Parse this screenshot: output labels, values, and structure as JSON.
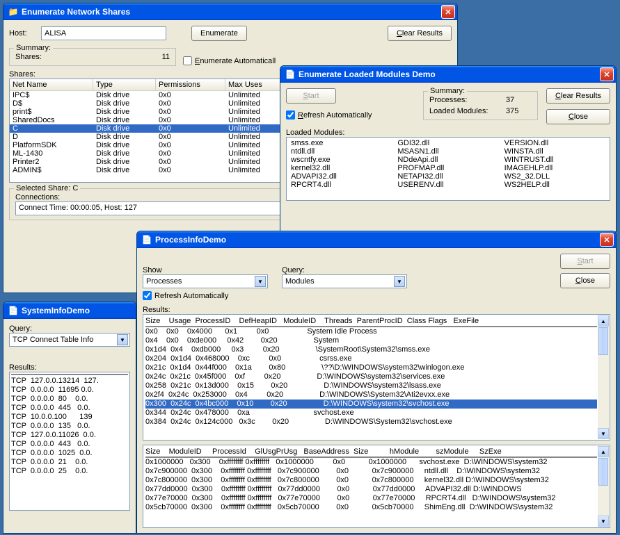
{
  "shares_win": {
    "title": "Enumerate Network Shares",
    "host_label": "Host:",
    "host_value": "ALISA",
    "enumerate_btn": "Enumerate",
    "clear_btn": "Clear Results",
    "summary_label": "Summary:",
    "summary_shares_label": "Shares:",
    "summary_shares_value": "11",
    "auto_label": "Enumerate Automatically",
    "caption": "Shares:",
    "cols": [
      "Net Name",
      "Type",
      "Permissions",
      "Max Uses"
    ],
    "rows": [
      {
        "name": "IPC$",
        "type": "Disk drive",
        "perm": "0x0",
        "max": "Unlimited",
        "sel": false
      },
      {
        "name": "D$",
        "type": "Disk drive",
        "perm": "0x0",
        "max": "Unlimited",
        "sel": false
      },
      {
        "name": "print$",
        "type": "Disk drive",
        "perm": "0x0",
        "max": "Unlimited",
        "sel": false
      },
      {
        "name": "SharedDocs",
        "type": "Disk drive",
        "perm": "0x0",
        "max": "Unlimited",
        "sel": false
      },
      {
        "name": "C",
        "type": "Disk drive",
        "perm": "0x0",
        "max": "Unlimited",
        "sel": true
      },
      {
        "name": "D",
        "type": "Disk drive",
        "perm": "0x0",
        "max": "Unlimited",
        "sel": false
      },
      {
        "name": "PlatformSDK",
        "type": "Disk drive",
        "perm": "0x0",
        "max": "Unlimited",
        "sel": false
      },
      {
        "name": "ML-1430",
        "type": "Disk drive",
        "perm": "0x0",
        "max": "Unlimited",
        "sel": false
      },
      {
        "name": "Printer2",
        "type": "Disk drive",
        "perm": "0x0",
        "max": "Unlimited",
        "sel": false
      },
      {
        "name": "ADMIN$",
        "type": "Disk drive",
        "perm": "0x0",
        "max": "Unlimited",
        "sel": false
      }
    ],
    "selected_legend": "Selected Share: C",
    "connections_label": "Connections:",
    "connections_text": "Connect Time: 00:00:05, Host: 127"
  },
  "modules_win": {
    "title": "Enumerate Loaded Modules Demo",
    "start_btn": "Start",
    "auto_label": "Refresh Automatically",
    "auto_checked": true,
    "summary_label": "Summary:",
    "proc_label": "Processes:",
    "proc_value": "37",
    "mod_label": "Loaded Modules:",
    "mod_value": "375",
    "clear_btn": "Clear Results",
    "close_btn": "Close",
    "caption": "Loaded Modules:",
    "grid": [
      [
        "smss.exe",
        "GDI32.dll",
        "VERSION.dll"
      ],
      [
        "ntdll.dll",
        "MSASN1.dll",
        "WINSTA.dll"
      ],
      [
        "wscntfy.exe",
        "NDdeApi.dll",
        "WINTRUST.dll"
      ],
      [
        "kernel32.dll",
        "PROFMAP.dll",
        "IMAGEHLP.dll"
      ],
      [
        "ADVAPI32.dll",
        "NETAPI32.dll",
        "WS2_32.DLL"
      ],
      [
        "RPCRT4.dll",
        "USERENV.dll",
        "WS2HELP.dll"
      ]
    ]
  },
  "sysinfo_win": {
    "title": "SystemInfoDemo",
    "query_label": "Query:",
    "query_value": "TCP Connect Table Info",
    "results_label": "Results:",
    "rows": [
      [
        "TCP",
        "127.0.0.1",
        "3214",
        "127."
      ],
      [
        "TCP",
        "0.0.0.0",
        "11695",
        "0.0."
      ],
      [
        "TCP",
        "0.0.0.0",
        "80",
        "0.0."
      ],
      [
        "TCP",
        "0.0.0.0",
        "445",
        "0.0."
      ],
      [
        "TCP",
        "10.0.0.100",
        "",
        "139"
      ],
      [
        "TCP",
        "0.0.0.0",
        "135",
        "0.0."
      ],
      [
        "TCP",
        "127.0.0.1",
        "1026",
        "0.0."
      ],
      [
        "TCP",
        "0.0.0.0",
        "443",
        "0.0."
      ],
      [
        "TCP",
        "0.0.0.0",
        "1025",
        "0.0."
      ],
      [
        "TCP",
        "0.0.0.0",
        "21",
        "0.0."
      ],
      [
        "TCP",
        "0.0.0.0",
        "25",
        "0.0."
      ]
    ]
  },
  "procinfo_win": {
    "title": "ProcessInfoDemo",
    "show_label": "Show",
    "show_value": "Processes",
    "query_label": "Query:",
    "query_value": "Modules",
    "start_btn": "Start",
    "close_btn": "Close",
    "auto_label": "Refresh Automatically",
    "auto_checked": true,
    "results_label": "Results:",
    "top_header": "Size    Usage  ProcessID    DefHeapID   ModuleID    Threads  ParentProcID  Class Flags   ExeFile",
    "top_rows": [
      {
        "t": "0x0    0x0    0x4000      0x1         0x0                  System Idle Process",
        "sel": false
      },
      {
        "t": "0x4    0x0    0xde000     0x42        0x20                 System",
        "sel": false
      },
      {
        "t": "0x1d4  0x4    0xdb000     0x3         0x20                 \\SystemRoot\\System32\\smss.exe",
        "sel": false
      },
      {
        "t": "0x204  0x1d4  0x468000    0xc         0x0                  csrss.exe",
        "sel": false
      },
      {
        "t": "0x21c  0x1d4  0x44f000    0x1a        0x80                 \\??\\D:\\WINDOWS\\system32\\winlogon.exe",
        "sel": false
      },
      {
        "t": "0x24c  0x21c  0x45f000    0xf         0x20                 D:\\WINDOWS\\system32\\services.exe",
        "sel": false
      },
      {
        "t": "0x258  0x21c  0x13d000    0x15        0x20                 D:\\WINDOWS\\system32\\lsass.exe",
        "sel": false
      },
      {
        "t": "0x2f4  0x24c  0x253000    0x4         0x20                 D:\\WINDOWS\\System32\\Ati2evxx.exe",
        "sel": false
      },
      {
        "t": "0x300  0x24c  0x4bc000    0x10        0x20                 D:\\WINDOWS\\system32\\svchost.exe",
        "sel": true
      },
      {
        "t": "0x344  0x24c  0x478000    0xa                              svchost.exe",
        "sel": false
      },
      {
        "t": "0x384  0x24c  0x124c000   0x3c        0x20                 D:\\WINDOWS\\System32\\svchost.exe",
        "sel": false
      }
    ],
    "bottom_header": "Size    ModuleID     ProcessId    GlUsgPrUsg   BaseAddress  Size          hModule        szModule     SzExe",
    "bottom_rows": [
      "0x1000000   0x300    0xffffffff 0xffffffff   0x1000000         0x0           0x1000000      svchost.exe  D:\\WINDOWS\\system32",
      "0x7c900000  0x300    0xffffffff 0xffffffff   0x7c900000        0x0           0x7c900000     ntdll.dll    D:\\WINDOWS\\system32",
      "0x7c800000  0x300    0xffffffff 0xffffffff   0x7c800000        0x0           0x7c800000     kernel32.dll D:\\WINDOWS\\system32",
      "0x77dd0000  0x300    0xffffffff 0xffffffff   0x77dd0000        0x0           0x77dd0000     ADVAPI32.dll D:\\WINDOWS",
      "0x77e70000  0x300    0xffffffff 0xffffffff   0x77e70000        0x0           0x77e70000     RPCRT4.dll   D:\\WINDOWS\\system32",
      "0x5cb70000  0x300    0xffffffff 0xffffffff   0x5cb70000        0x0           0x5cb70000     ShimEng.dll  D:\\WINDOWS\\system32"
    ]
  }
}
